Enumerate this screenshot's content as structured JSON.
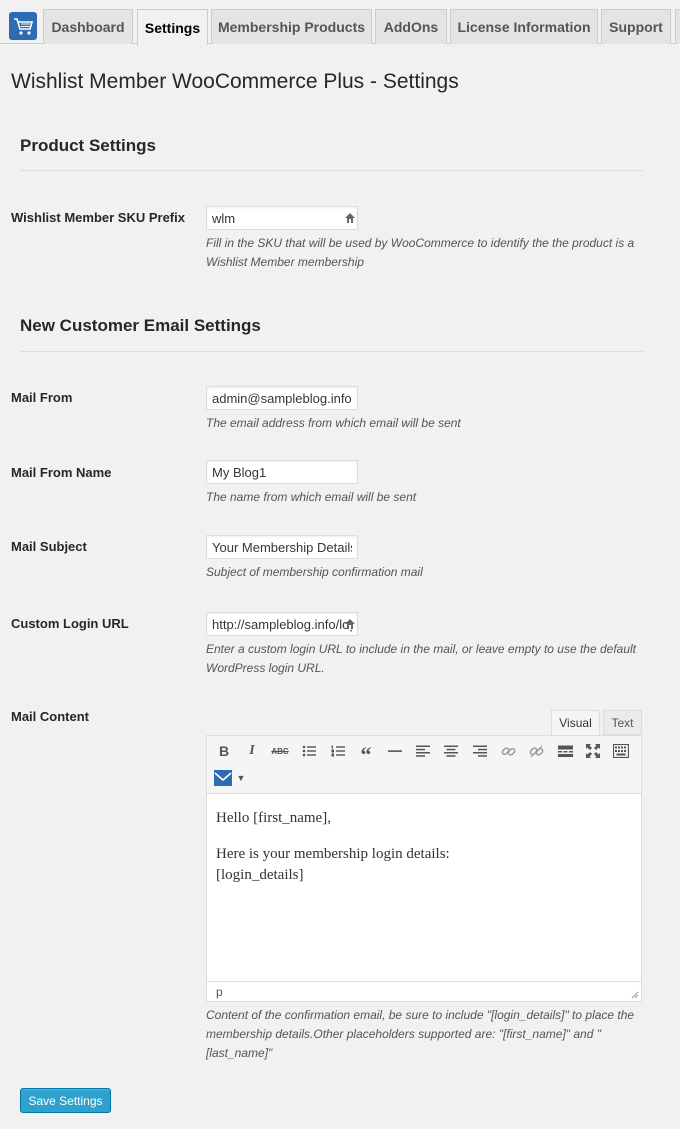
{
  "tabs": [
    "Dashboard",
    "Settings",
    "Membership Products",
    "AddOns",
    "License Information",
    "Support"
  ],
  "active_tab": "Settings",
  "page_title": "Wishlist Member WooCommerce Plus - Settings",
  "product_settings": {
    "title": "Product Settings",
    "sku_label": "Wishlist Member SKU Prefix",
    "sku_value": "wlm",
    "sku_desc": "Fill in the SKU that will be used by WooCommerce to identify the the product is a Wishlist Member membership"
  },
  "email_settings": {
    "title": "New Customer Email Settings",
    "mail_from_label": "Mail From",
    "mail_from_value": "admin@sampleblog.info",
    "mail_from_desc": "The email address from which email will be sent",
    "mail_from_name_label": "Mail From Name",
    "mail_from_name_value": "My Blog1",
    "mail_from_name_desc": "The name from which email will be sent",
    "mail_subject_label": "Mail Subject",
    "mail_subject_value": "Your Membership Details",
    "mail_subject_desc": "Subject of membership confirmation mail",
    "login_url_label": "Custom Login URL",
    "login_url_value": "http://sampleblog.info/login",
    "login_url_desc": "Enter a custom login URL to include in the mail, or leave empty to use the default WordPress login URL.",
    "mail_content_label": "Mail Content"
  },
  "editor": {
    "tab_visual": "Visual",
    "tab_text": "Text",
    "line1": "Hello [first_name],",
    "line2": "Here is your membership login details:",
    "line3": "[login_details]",
    "path": "p",
    "desc": "Content of the confirmation email, be sure to include \"[login_details]\" to place the membership details.Other placeholders supported are: \"[first_name]\" and \"[last_name]\""
  },
  "save_label": "Save Settings",
  "colors": {
    "accent": "#2ea2cc",
    "logo": "#2d6bb2"
  }
}
